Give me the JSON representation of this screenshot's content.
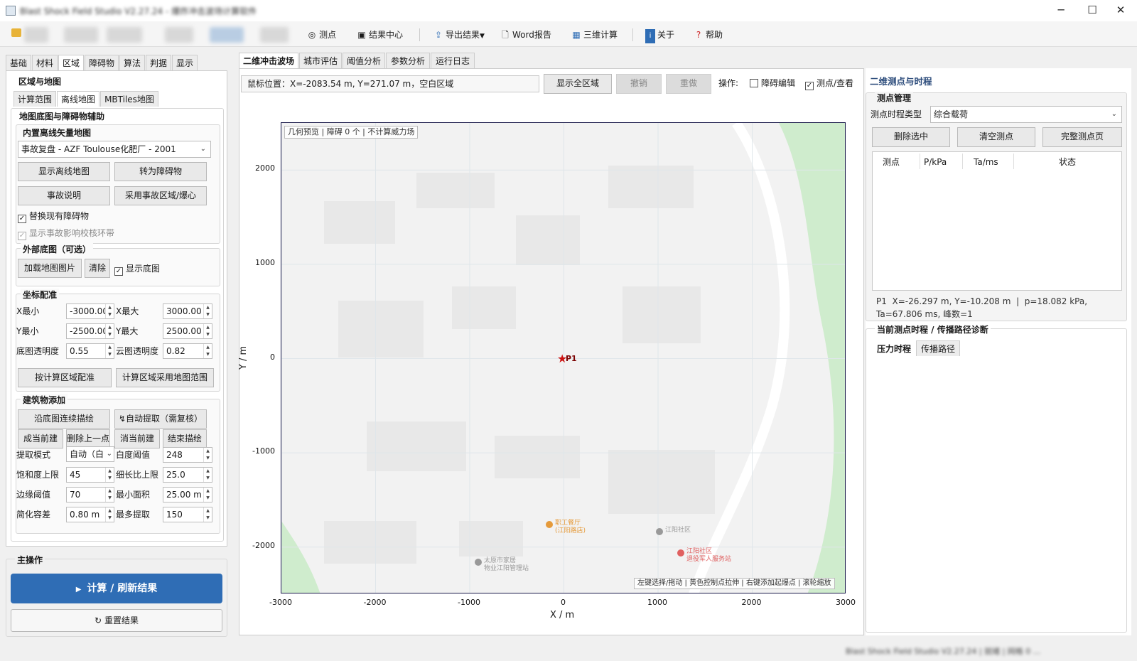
{
  "window": {
    "title": "Blast Shock Field Studio V2.27.24 - 爆炸冲击波场计算软件",
    "controls": [
      "─",
      "☐",
      "✕"
    ]
  },
  "toolbar": {
    "items": [
      {
        "icon": "target-icon",
        "label": "测点"
      },
      {
        "icon": "results-icon",
        "label": "结果中心"
      },
      {
        "icon": "export-icon",
        "label": "导出结果"
      },
      {
        "icon": "word-icon",
        "label": "Word报告"
      },
      {
        "icon": "3d-calc-icon",
        "label": "三维计算"
      },
      {
        "icon": "info-icon",
        "label": "关于"
      },
      {
        "icon": "help-icon",
        "label": "帮助"
      }
    ]
  },
  "left": {
    "tabs": [
      "基础",
      "材料",
      "区域",
      "障碍物",
      "算法",
      "判据",
      "显示"
    ],
    "section_title": "区域与地图",
    "subtabs": [
      "计算范围",
      "离线地图",
      "MBTiles地图"
    ],
    "map_group_title": "地图底图与障碍物辅助",
    "builtin_title": "内置离线矢量地图",
    "map_select": "事故复盘 - AZF Toulouse化肥厂 - 2001",
    "btn_show_offline": "显示离线地图",
    "btn_to_obstacle": "转为障碍物",
    "btn_accident_info": "事故说明",
    "btn_use_accident": "采用事故区域/爆心",
    "chk_replace": "替换现有障碍物",
    "chk_ring": "显示事故影响校核环带",
    "external_title": "外部底图（可选）",
    "btn_load_image": "加载地图图片",
    "btn_clear": "清除",
    "chk_show_base": "显示底图",
    "coord_title": "坐标配准",
    "xmin_label": "X最小",
    "xmin": "-3000.00",
    "xmax_label": "X最大",
    "xmax": "3000.00",
    "ymin_label": "Y最小",
    "ymin": "-2500.00",
    "ymax_label": "Y最大",
    "ymax": "2500.00",
    "base_alpha_label": "底图透明度",
    "base_alpha": "0.55",
    "cloud_alpha_label": "云图透明度",
    "cloud_alpha": "0.82",
    "btn_fit_calc": "按计算区域配准",
    "btn_calc_use_map": "计算区域采用地图范围",
    "building_title": "建筑物添加",
    "btn_trace": "沿底图连续描绘",
    "btn_auto_extract": "↯自动提取（需复核）",
    "btn_finish_current": "成当前建",
    "btn_delete_prev": "删除上一点",
    "btn_cancel_current": "消当前建",
    "btn_end_trace": "结束描绘",
    "mode_label": "提取模式",
    "mode": "自动（白",
    "white_label": "白度阈值",
    "white": "248",
    "sat_label": "饱和度上限",
    "sat": "45",
    "elong_label": "细长比上限",
    "elong": "25.0",
    "edge_label": "边缘阈值",
    "edge": "70",
    "minarea_label": "最小面积",
    "minarea": "25.00 m",
    "simp_label": "简化容差",
    "simp": "0.80 m",
    "maxext_label": "最多提取",
    "maxext": "150",
    "main_ops_title": "主操作",
    "btn_compute": "计算 / 刷新结果",
    "btn_reset": "重置结果"
  },
  "center": {
    "tabs": [
      "二维冲击波场",
      "城市评估",
      "阈值分析",
      "参数分析",
      "运行日志"
    ],
    "mouse_pos": "鼠标位置：X=-2083.54 m, Y=271.07 m，空白区域",
    "btn_show_all": "显示全区域",
    "btn_undo": "撤销",
    "btn_redo": "重做",
    "ops_label": "操作:",
    "chk_obstacle_edit": "障碍编辑",
    "chk_probe_view": "测点/查看",
    "preview_badge": "几何预览 | 障碍 0 个 | 不计算威力场",
    "hint_bar": "左键选择/拖动 | 黄色控制点拉伸 | 右键添加起爆点 | 滚轮缩放",
    "probe_label": "P1",
    "xlabel": "X / m",
    "ylabel": "Y / m",
    "x_ticks": [
      "-3000",
      "-2000",
      "-1000",
      "0",
      "1000",
      "2000",
      "3000"
    ],
    "y_ticks": [
      "2000",
      "1000",
      "0",
      "-1000",
      "-2000"
    ],
    "map_labels": {
      "poi1": "职工餐厅\n(江阳路店)",
      "poi2": "江阳社区",
      "poi3": "江阳社区\n退役军人服务站",
      "poi4": "太原市家居\n物业江阳管理站"
    }
  },
  "right": {
    "title": "二维测点与时程",
    "probe_mgmt_title": "测点管理",
    "type_label": "测点时程类型",
    "type_value": "综合载荷",
    "btn_delete_sel": "删除选中",
    "btn_clear_probes": "清空测点",
    "btn_full_page": "完整测点页",
    "table_headers": [
      "测点",
      "P/kPa",
      "Ta/ms",
      "状态"
    ],
    "probe_info": "P1  X=-26.297 m, Y=-10.208 m  |  p=18.082 kPa,\nTa=67.806 ms, 峰数=1",
    "history_title": "当前测点时程 / 传播路径诊断",
    "history_tabs": [
      "压力时程",
      "传播路径"
    ]
  },
  "statusbar": {
    "text": "Blast Shock Field Studio V2.27.24 | 就绪 | 网格 0 ..."
  },
  "colors": {
    "accent": "#2f6db5",
    "map_green": "#cfeccd",
    "map_bg": "#f2f2f2",
    "probe_star": "#cc1111"
  }
}
